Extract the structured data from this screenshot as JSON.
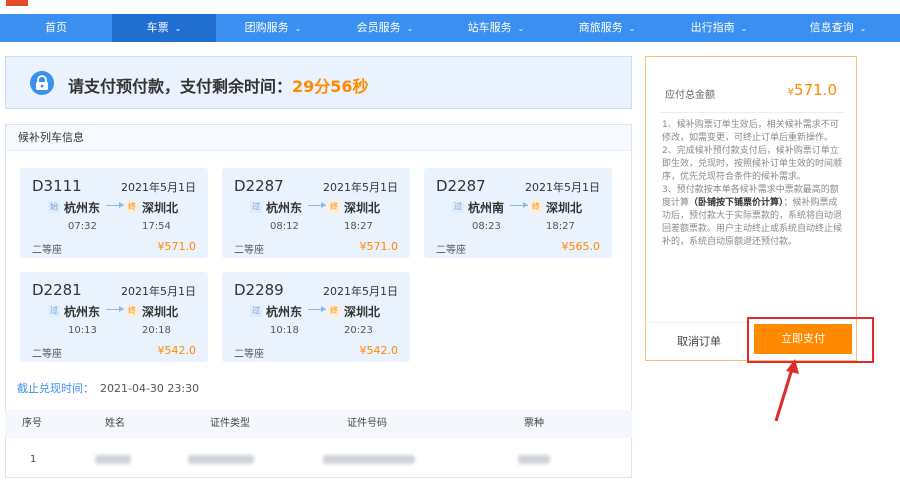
{
  "nav": {
    "items": [
      {
        "label": "首页",
        "caret": false
      },
      {
        "label": "车票",
        "caret": true
      },
      {
        "label": "团购服务",
        "caret": true
      },
      {
        "label": "会员服务",
        "caret": true
      },
      {
        "label": "站车服务",
        "caret": true
      },
      {
        "label": "商旅服务",
        "caret": true
      },
      {
        "label": "出行指南",
        "caret": true
      },
      {
        "label": "信息查询",
        "caret": true
      }
    ],
    "caret_glyph": "⌄",
    "active_index": 1
  },
  "banner": {
    "prefix": "请支付预付款，支付剩余时间：",
    "time": "29分56秒"
  },
  "panel": {
    "title": "候补列车信息"
  },
  "tickets": [
    {
      "code": "D3111",
      "date": "2021年5月1日",
      "from": "杭州东",
      "to": "深圳北",
      "depart": "07:32",
      "arrive": "17:54",
      "seat": "二等座",
      "price": "¥571.0",
      "from_badge": "始",
      "to_badge": "终"
    },
    {
      "code": "D2287",
      "date": "2021年5月1日",
      "from": "杭州东",
      "to": "深圳北",
      "depart": "08:12",
      "arrive": "18:27",
      "seat": "二等座",
      "price": "¥571.0",
      "from_badge": "过",
      "to_badge": "终"
    },
    {
      "code": "D2287",
      "date": "2021年5月1日",
      "from": "杭州南",
      "to": "深圳北",
      "depart": "08:23",
      "arrive": "18:27",
      "seat": "二等座",
      "price": "¥565.0",
      "from_badge": "过",
      "to_badge": "终"
    },
    {
      "code": "D2281",
      "date": "2021年5月1日",
      "from": "杭州东",
      "to": "深圳北",
      "depart": "10:13",
      "arrive": "20:18",
      "seat": "二等座",
      "price": "¥542.0",
      "from_badge": "过",
      "to_badge": "终"
    },
    {
      "code": "D2289",
      "date": "2021年5月1日",
      "from": "杭州东",
      "to": "深圳北",
      "depart": "10:18",
      "arrive": "20:23",
      "seat": "二等座",
      "price": "¥542.0",
      "from_badge": "过",
      "to_badge": "终"
    }
  ],
  "deadline": {
    "label": "截止兑现时间：",
    "value": "2021-04-30 23:30"
  },
  "table": {
    "headers": [
      "序号",
      "姓名",
      "证件类型",
      "证件号码",
      "票种"
    ],
    "rows": [
      {
        "index": "1"
      }
    ]
  },
  "summary": {
    "total_label": "应付总金额",
    "currency": "¥",
    "total_value": "571.0",
    "notes": [
      "1、候补购票订单生效后，相关候补需求不可修改，如需变更，可终止订单后重新操作。",
      "2、完成候补预付款支付后，候补购票订单立即生效，兑现时，按照候补订单生效的时间顺序，优先兑现符合条件的候补需求。",
      "3、预付款按本单各候补需求中票款最高的额度计算"
    ],
    "note3_bold": "（卧铺按下铺票价计算）",
    "note3_tail": "；候补购票成功后，预付款大于实际票款的，系统将自动退回差额票款。用户主动终止或系统自动终止候补的，系统自动原额退还预付款。",
    "cancel_label": "取消订单",
    "pay_label": "立即支付"
  },
  "colors": {
    "nav_blue": "#3b8ff0",
    "accent_orange": "#ff8a00",
    "annotation_red": "#e12b2b"
  }
}
